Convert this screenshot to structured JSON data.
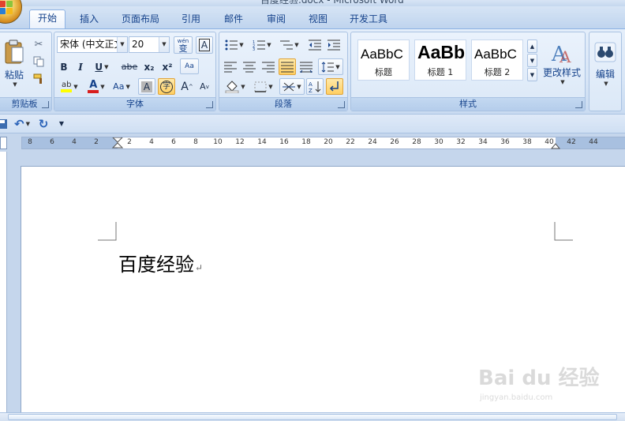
{
  "window": {
    "title": "百度经验.docx - Microsoft Word"
  },
  "tabs": [
    {
      "label": "开始",
      "active": true
    },
    {
      "label": "插入"
    },
    {
      "label": "页面布局"
    },
    {
      "label": "引用"
    },
    {
      "label": "邮件"
    },
    {
      "label": "审阅"
    },
    {
      "label": "视图"
    },
    {
      "label": "开发工具"
    }
  ],
  "clipboard": {
    "paste_label": "粘贴",
    "group_label": "剪贴板"
  },
  "font": {
    "group_label": "字体",
    "font_name": "宋体 (中文正文)",
    "font_size": "20",
    "phonetic_glyph": "wén",
    "phonetic_char": "变",
    "border_char": "A",
    "bold": "B",
    "italic": "I",
    "underline": "U",
    "strike": "abe",
    "subscript": "x₂",
    "superscript": "x²",
    "clear_format": "Aa",
    "highlight": "ab",
    "font_color": "A",
    "change_case": "Aa",
    "char_shading": "A",
    "enclose_char": "字",
    "grow": "A",
    "shrink": "A",
    "font_color_value": "#d81e1e",
    "highlight_value": "#ffff00"
  },
  "paragraph": {
    "group_label": "段落"
  },
  "styles": {
    "group_label": "样式",
    "items": [
      {
        "sample": "AaBbC",
        "name": "标题"
      },
      {
        "sample": "AaBb",
        "name": "标题 1"
      },
      {
        "sample": "AaBbC",
        "name": "标题 2"
      }
    ],
    "change_styles": "更改样式"
  },
  "editing": {
    "label": "编辑"
  },
  "ruler": {
    "numbers": [
      "8",
      "6",
      "4",
      "2",
      "2",
      "4",
      "6",
      "8",
      "10",
      "12",
      "14",
      "16",
      "18",
      "20",
      "22",
      "24",
      "26",
      "28",
      "30",
      "32",
      "34",
      "36",
      "38",
      "40",
      "42",
      "44"
    ]
  },
  "document": {
    "text": "百度经验",
    "para_mark": "↵"
  },
  "watermark": {
    "main": "Bai du 经验",
    "sub": "jingyan.baidu.com"
  }
}
